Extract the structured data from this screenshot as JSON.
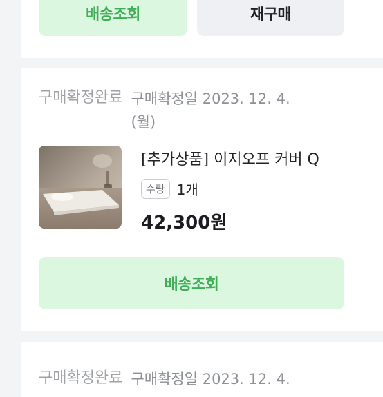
{
  "top_actions": {
    "delivery_tracking_label": "배송조회",
    "reorder_label": "재구매"
  },
  "orders": [
    {
      "status": "구매확정완료",
      "confirm_date": "구매확정일 2023. 12. 4. (월)",
      "product": {
        "name": "[추가상품] 이지오프 커버 Q",
        "quantity_badge": "수량",
        "quantity": "1개",
        "price": "42,300원"
      },
      "delivery_tracking_label": "배송조회"
    },
    {
      "status": "구매확정완료",
      "confirm_date": "구매확정일 2023. 12. 4."
    }
  ],
  "colors": {
    "accent_green": "#3fae57",
    "accent_green_bg": "#dbf7e0",
    "page_bg": "#f3f4f6"
  }
}
